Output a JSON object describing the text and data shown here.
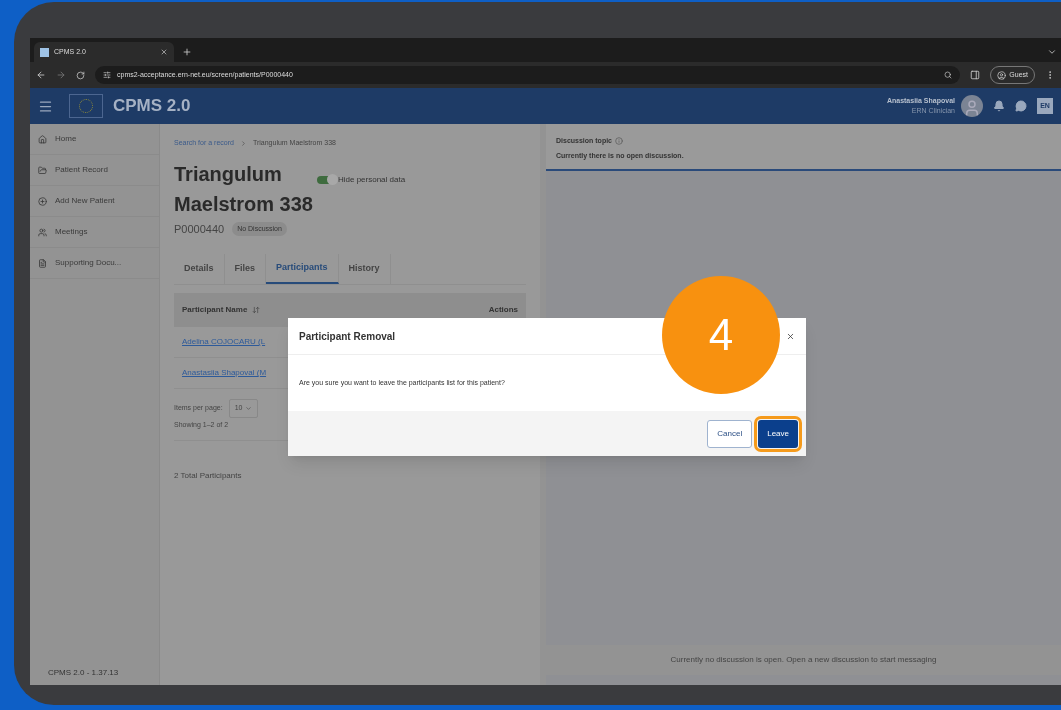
{
  "browser": {
    "tab_title": "CPMS 2.0",
    "url": "cpms2-acceptance.ern-net.eu/screen/patients/P0000440",
    "profile": "Guest"
  },
  "header": {
    "app_name": "CPMS 2.0",
    "user_name": "Anastasiia Shapoval",
    "user_role": "ERN Clinician",
    "language": "EN"
  },
  "sidebar": {
    "items": [
      {
        "label": "Home"
      },
      {
        "label": "Patient Record"
      },
      {
        "label": "Add New Patient"
      },
      {
        "label": "Meetings"
      },
      {
        "label": "Supporting Docu..."
      }
    ],
    "version": "CPMS 2.0 - 1.37.13"
  },
  "breadcrumb": [
    "Search for a record",
    "Triangulum Maelstrom 338"
  ],
  "patient": {
    "name_line_1": "Triangulum",
    "name_line_2": "Maelstrom 338",
    "id": "P0000440",
    "status_badge": "No Discussion"
  },
  "hide_personal_data": {
    "label": "Hide personal data",
    "on": true
  },
  "tabs": [
    {
      "label": "Details",
      "selected": false
    },
    {
      "label": "Files",
      "selected": false
    },
    {
      "label": "Participants",
      "selected": true
    },
    {
      "label": "History",
      "selected": false
    }
  ],
  "table": {
    "columns": [
      "Participant Name",
      "Actions"
    ],
    "rows": [
      "Adelina COJOCARU (L",
      "Anastasiia Shapoval (M"
    ]
  },
  "pagination": {
    "label": "Items per page:",
    "value": "10",
    "showing": "Showing 1–2 of 2"
  },
  "total": "2 Total Participants",
  "discussion": {
    "title": "Discussion topic",
    "status": "Currently there is no open discussion.",
    "footer": "Currently no discussion is open. Open a new discussion to start messaging"
  },
  "dialog": {
    "title": "Participant Removal",
    "message": "Are you sure you want to leave the participants list for this patient?",
    "buttons": [
      {
        "label": "Cancel",
        "kind": "secondary",
        "highlighted": false
      },
      {
        "label": "Leave",
        "kind": "primary",
        "highlighted": true
      }
    ]
  },
  "step_badge": "4"
}
